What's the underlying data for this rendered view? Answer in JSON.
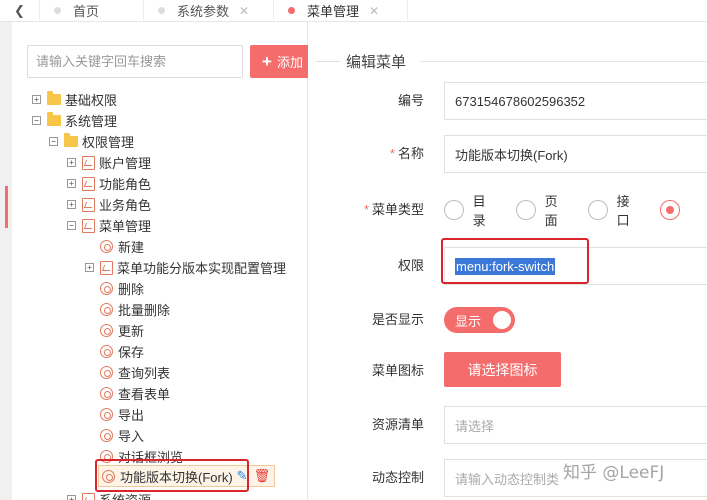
{
  "tabs": [
    {
      "label": "首页",
      "closable": false,
      "active": false
    },
    {
      "label": "系统参数",
      "closable": true,
      "active": false
    },
    {
      "label": "菜单管理",
      "closable": true,
      "active": true
    }
  ],
  "tree_panel": {
    "search_placeholder": "请输入关键字回车搜索",
    "add_label": "添加",
    "nodes": [
      {
        "label": "基础权限",
        "type": "folder",
        "expander": "+"
      },
      {
        "label": "系统管理",
        "type": "folder",
        "expander": "−"
      },
      {
        "label": "权限管理",
        "type": "folder",
        "expander": "−"
      },
      {
        "label": "账户管理",
        "type": "menu",
        "expander": "+"
      },
      {
        "label": "功能角色",
        "type": "menu",
        "expander": "+"
      },
      {
        "label": "业务角色",
        "type": "menu",
        "expander": "+"
      },
      {
        "label": "菜单管理",
        "type": "menu",
        "expander": "−"
      },
      {
        "label": "新建",
        "type": "button"
      },
      {
        "label": "菜单功能分版本实现配置管理",
        "type": "menu",
        "expander": "+"
      },
      {
        "label": "删除",
        "type": "button"
      },
      {
        "label": "批量删除",
        "type": "button"
      },
      {
        "label": "更新",
        "type": "button"
      },
      {
        "label": "保存",
        "type": "button"
      },
      {
        "label": "查询列表",
        "type": "button"
      },
      {
        "label": "查看表单",
        "type": "button"
      },
      {
        "label": "导出",
        "type": "button"
      },
      {
        "label": "导入",
        "type": "button"
      },
      {
        "label": "对话框浏览",
        "type": "button"
      },
      {
        "label": "功能版本切换(Fork)",
        "type": "button",
        "selected": true
      },
      {
        "label": "系统资源",
        "type": "menu",
        "expander": "+"
      }
    ]
  },
  "form": {
    "title": "编辑菜单",
    "id_label": "编号",
    "id_value": "673154678602596352",
    "name_label": "名称",
    "name_value": "功能版本切换(Fork)",
    "type_label": "菜单类型",
    "type_options": [
      "目录",
      "页面",
      "接口"
    ],
    "permission_label": "权限",
    "permission_value": "menu:fork-switch",
    "show_label": "是否显示",
    "show_value": "显示",
    "icon_label": "菜单图标",
    "icon_button": "请选择图标",
    "resource_label": "资源清单",
    "resource_placeholder": "请选择",
    "dynamic_label": "动态控制",
    "dynamic_placeholder": "请输入动态控制类"
  },
  "watermark": "知乎 @LeeFJ",
  "colors": {
    "accent": "#f56c6c",
    "highlight_box": "#d9252d",
    "selection": "#3b78d8"
  }
}
